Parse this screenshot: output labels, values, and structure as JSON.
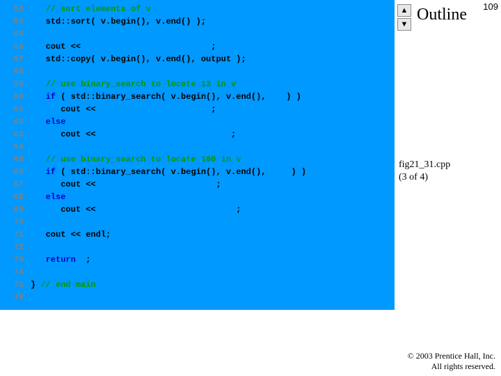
{
  "page_number": "109",
  "outline_label": "Outline",
  "fig_label_line1": "fig21_31.cpp",
  "fig_label_line2": "(3 of 4)",
  "copyright_line1": "© 2003 Prentice Hall, Inc.",
  "copyright_line2": "All rights reserved.",
  "arrow_up": "▲",
  "arrow_down": "▼",
  "code_lines": [
    {
      "n": "53",
      "segs": [
        {
          "cls": "indent",
          "txt": "   "
        },
        {
          "cls": "c-comment",
          "txt": "// sort elements of v"
        }
      ]
    },
    {
      "n": "54",
      "segs": [
        {
          "cls": "indent",
          "txt": "   "
        },
        {
          "cls": "c-default",
          "txt": "std::sort( v.begin(), v.end() );"
        }
      ]
    },
    {
      "n": "55",
      "segs": []
    },
    {
      "n": "56",
      "segs": [
        {
          "cls": "indent",
          "txt": "   "
        },
        {
          "cls": "c-default",
          "txt": "cout <<                          ;"
        }
      ]
    },
    {
      "n": "57",
      "segs": [
        {
          "cls": "indent",
          "txt": "   "
        },
        {
          "cls": "c-default",
          "txt": "std::copy( v.begin(), v.end(), output );"
        }
      ]
    },
    {
      "n": "58",
      "segs": []
    },
    {
      "n": "59",
      "segs": [
        {
          "cls": "indent",
          "txt": "   "
        },
        {
          "cls": "c-comment",
          "txt": "// use binary_search to locate 13 in v"
        }
      ]
    },
    {
      "n": "60",
      "segs": [
        {
          "cls": "indent",
          "txt": "   "
        },
        {
          "cls": "c-kw",
          "txt": "if"
        },
        {
          "cls": "c-default",
          "txt": " ( std::binary_search( v.begin(), v.end(),    ) )"
        }
      ]
    },
    {
      "n": "61",
      "segs": [
        {
          "cls": "indent",
          "txt": "      "
        },
        {
          "cls": "c-default",
          "txt": "cout <<                       ;"
        }
      ]
    },
    {
      "n": "62",
      "segs": [
        {
          "cls": "indent",
          "txt": "   "
        },
        {
          "cls": "c-kw",
          "txt": "else"
        }
      ]
    },
    {
      "n": "63",
      "segs": [
        {
          "cls": "indent",
          "txt": "      "
        },
        {
          "cls": "c-default",
          "txt": "cout <<                           ;"
        }
      ]
    },
    {
      "n": "64",
      "segs": []
    },
    {
      "n": "65",
      "segs": [
        {
          "cls": "indent",
          "txt": "   "
        },
        {
          "cls": "c-comment",
          "txt": "// use binary_search to locate 100 in v"
        }
      ]
    },
    {
      "n": "66",
      "segs": [
        {
          "cls": "indent",
          "txt": "   "
        },
        {
          "cls": "c-kw",
          "txt": "if"
        },
        {
          "cls": "c-default",
          "txt": " ( std::binary_search( v.begin(), v.end(),     ) )"
        }
      ]
    },
    {
      "n": "67",
      "segs": [
        {
          "cls": "indent",
          "txt": "      "
        },
        {
          "cls": "c-default",
          "txt": "cout <<                        ;"
        }
      ]
    },
    {
      "n": "68",
      "segs": [
        {
          "cls": "indent",
          "txt": "   "
        },
        {
          "cls": "c-kw",
          "txt": "else"
        }
      ]
    },
    {
      "n": "69",
      "segs": [
        {
          "cls": "indent",
          "txt": "      "
        },
        {
          "cls": "c-default",
          "txt": "cout <<                            ;"
        }
      ]
    },
    {
      "n": "70",
      "segs": []
    },
    {
      "n": "71",
      "segs": [
        {
          "cls": "indent",
          "txt": "   "
        },
        {
          "cls": "c-default",
          "txt": "cout << endl;"
        }
      ]
    },
    {
      "n": "72",
      "segs": []
    },
    {
      "n": "73",
      "segs": [
        {
          "cls": "indent",
          "txt": "   "
        },
        {
          "cls": "c-kw",
          "txt": "return"
        },
        {
          "cls": "c-default",
          "txt": "  ;"
        }
      ]
    },
    {
      "n": "74",
      "segs": []
    },
    {
      "n": "75",
      "segs": [
        {
          "cls": "c-default",
          "txt": "} "
        },
        {
          "cls": "c-comment",
          "txt": "// end main"
        }
      ]
    },
    {
      "n": "76",
      "segs": []
    }
  ]
}
